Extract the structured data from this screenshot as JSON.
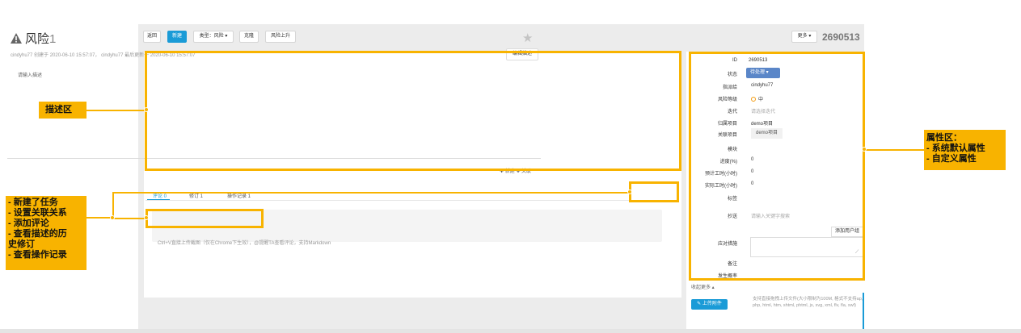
{
  "toolbar": {
    "back_label": "返回",
    "new_label": "新建",
    "type_label": "类型：风险 ▾",
    "clone_label": "克隆",
    "escalate_label": "风险上升",
    "more_label": "更多 ▾",
    "record_id": "2690513"
  },
  "description": {
    "title": "风险",
    "title_number": "1",
    "meta": "cindyhu77 创建于 2020-06-10 15:57:07，  cindyhu77 最后更新于 2020-06-10 15:57:07",
    "edit_label": "编辑描述",
    "placeholder": "请输入描述"
  },
  "link_actions": "✚ 新建  ✚ 关联",
  "tabs": [
    {
      "label": "评论 0"
    },
    {
      "label": "修订 1"
    },
    {
      "label": "操作记录 1"
    }
  ],
  "comment": {
    "placeholder": "Ctrl+V直接上传截图（仅在Chrome下生效），@提醒TA查看评论，支持Markdown"
  },
  "properties": {
    "id_label": "ID",
    "id_value": "2690513",
    "status_label": "状态",
    "status_value": "待处理 ▾",
    "assignee_label": "指派给",
    "assignee_value": "cindyhu77",
    "level_label": "风险等级",
    "level_value": "中",
    "iteration_label": "迭代",
    "iteration_value": "请选择迭代",
    "project_label": "归属项目",
    "project_value": "demo项目",
    "related_label": "关联项目",
    "related_value": "demo项目",
    "module_label": "模块",
    "progress_label": "进度(%)",
    "progress_value": "0",
    "estimated_label": "预计工时(小时)",
    "estimated_value": "0",
    "actual_label": "实际工时(小时)",
    "actual_value": "0",
    "tags_label": "标签",
    "followers_label": "抄送",
    "followers_placeholder": "请输入关键字搜索",
    "add_group_label": "添加用户组",
    "response_label": "应对措施",
    "remark_label": "备注",
    "probability_label": "发生概率",
    "collapse_label": "收起更多 ▴",
    "upload_label": "✎ 上传附件",
    "upload_note": "支持直接拖拽上传文件(大小限制为100M, 格式不支持ap, php, html, htm, shtml, phtml, js, svg, xml, flv, fla, swf)"
  },
  "annotations": {
    "desc_area": "描述区",
    "bottom_area": "- 新建了任务\n- 设置关联关系\n- 添加评论\n- 查看描述的历\n史修订\n- 查看操作记录",
    "prop_area": "属性区：\n- 系统默认属性\n- 自定义属性"
  },
  "colors": {
    "accent": "#1a9bd7",
    "highlight": "#f8b300",
    "status": "#5a86c8"
  }
}
